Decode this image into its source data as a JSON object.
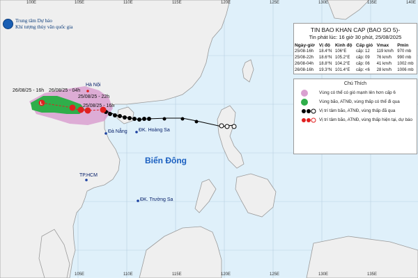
{
  "map": {
    "longitude_labels": [
      "100E",
      "105E",
      "110E",
      "115E",
      "120E",
      "125E",
      "130E",
      "135E",
      "140E"
    ],
    "agency": {
      "line1": "Trung tâm Dự báo",
      "line2": "Khí tượng thủy văn quốc gia"
    },
    "places": {
      "hanoi": "Hà Nội",
      "danang": "Đà Nẵng",
      "hoangsa": "ĐK. Hoàng Sa",
      "tphcm": "TP.HCM",
      "truongsa": "ĐK. Trường Sa"
    },
    "sea_name": "Biển Đông",
    "track_labels": [
      "26/08/25 - 16h",
      "26/08/25 - 04h",
      "25/08/25 - 22h",
      "25/08/25 - 16h"
    ],
    "colors": {
      "sea": "#dff0fa",
      "land": "#efefef",
      "danger_zone": "#d9a0d0",
      "wind_zone": "#2fae4a",
      "forecast_storm": "#e02020",
      "track": "#000000"
    }
  },
  "info": {
    "title": "TIN BAO KHAN CAP (BAO SO 5)-",
    "issued": "Tin phát lúc: 16 giờ 30 phút, 25/08/2025",
    "headers": [
      "Ngày-giờ",
      "Vị độ",
      "Kinh độ",
      "Cấp gió",
      "Vmax",
      "Pmin"
    ],
    "rows": [
      [
        "25/08-16h",
        "18.4°N",
        "106°E",
        "cấp: 12",
        "119 km/h",
        "970 mb"
      ],
      [
        "25/08-22h",
        "18.6°N",
        "105.2°E",
        "cấp: 09",
        "76 km/h",
        "990 mb"
      ],
      [
        "26/08-04h",
        "18.8°N",
        "104.2°E",
        "cấp: 06",
        "41 km/h",
        "1002 mb"
      ],
      [
        "26/08-16h",
        "19.3°N",
        "101.4°E",
        "cấp: <6",
        "28 km/h",
        "1006 mb"
      ]
    ]
  },
  "legend": {
    "title": "Chú Thích",
    "items": [
      {
        "text": "Vùng có thể có gió mạnh lên hơn cấp 6",
        "icon": "purple-zone-swatch",
        "color": "#d9a0d0"
      },
      {
        "text": "Vùng bão, ATNĐ, vùng thấp có thể đi qua",
        "icon": "green-zone-swatch",
        "color": "#2fae4a"
      },
      {
        "text": "Vị trí tâm bão, ATNĐ, vùng thấp đã qua",
        "icon": "past-storm-symbols",
        "color": "#000000"
      },
      {
        "text": "Vị trí tâm bão, ATNĐ, vùng thấp hiện tại, dự báo",
        "icon": "forecast-storm-symbols",
        "color": "#e02020"
      }
    ]
  }
}
